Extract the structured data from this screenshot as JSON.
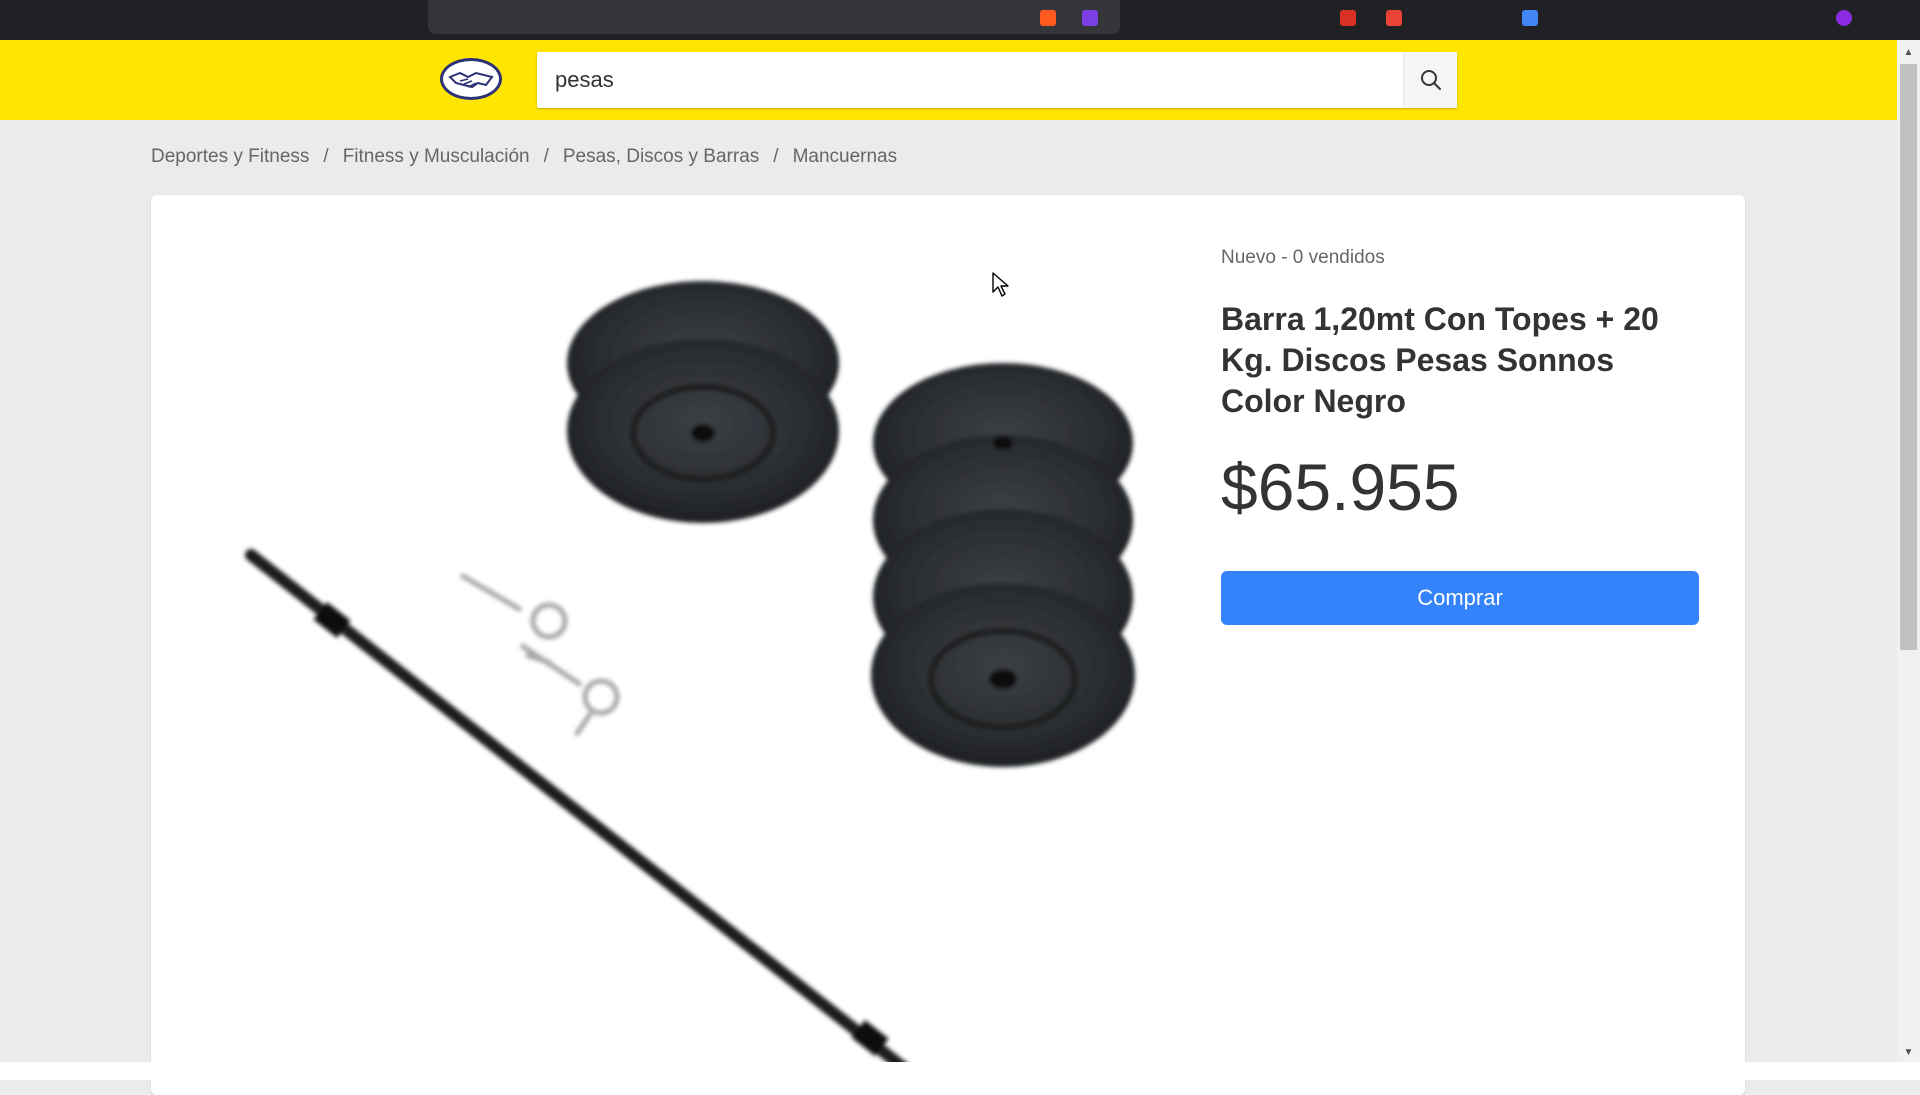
{
  "search": {
    "value": "pesas"
  },
  "breadcrumb": {
    "items": [
      "Deportes y Fitness",
      "Fitness y Musculación",
      "Pesas, Discos y Barras",
      "Mancuernas"
    ],
    "separator": "/"
  },
  "product": {
    "condition": "Nuevo - 0 vendidos",
    "title": "Barra 1,20mt Con Topes + 20 Kg. Discos Pesas Sonnos Color Negro",
    "price": "$65.955",
    "buy_label": "Comprar"
  },
  "colors": {
    "header": "#ffe600",
    "primary_button": "#3483fa",
    "page_background": "#ebebeb"
  },
  "icons": {
    "logo": "handshake-logo",
    "search": "search-icon"
  }
}
